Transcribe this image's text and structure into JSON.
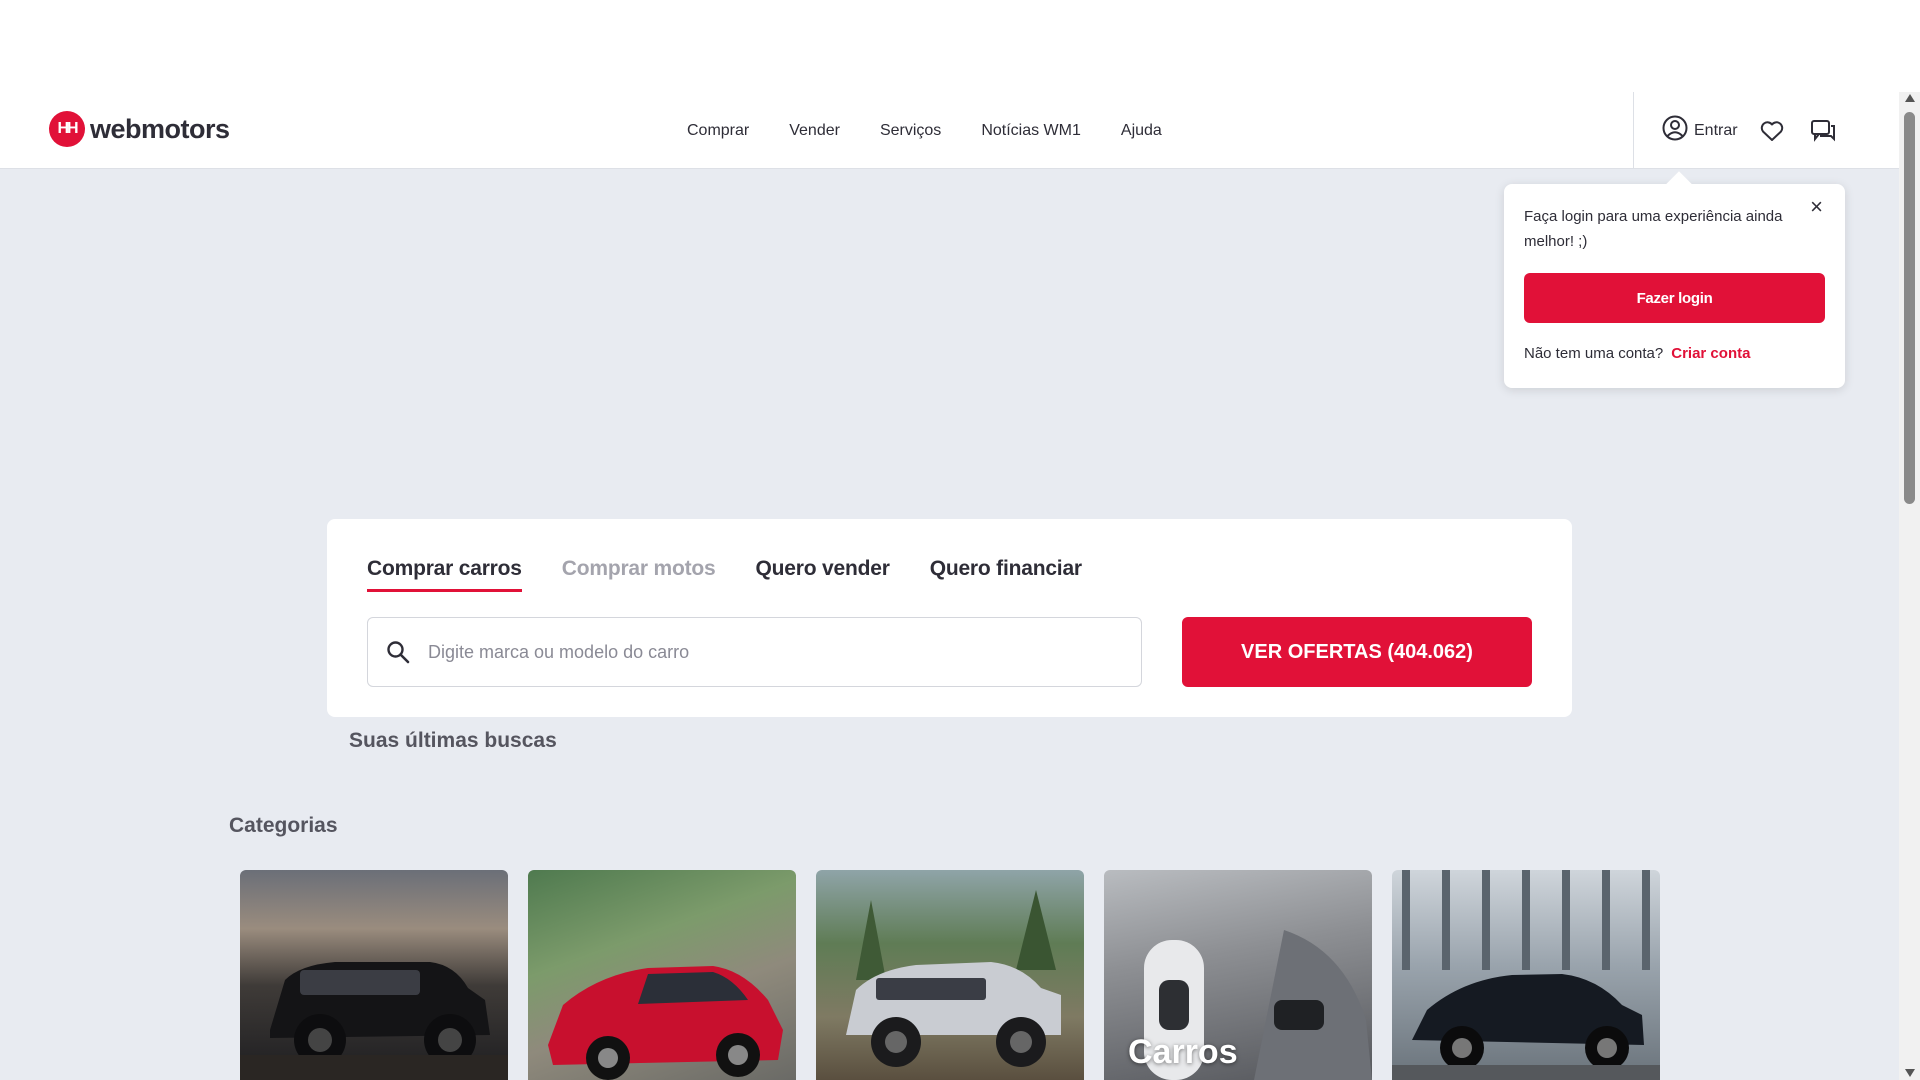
{
  "header": {
    "logo_mark": "HH",
    "logo_text": "webmotors",
    "nav": [
      "Comprar",
      "Vender",
      "Serviços",
      "Notícias WM1",
      "Ajuda"
    ],
    "login_label": "Entrar"
  },
  "popover": {
    "message": "Faça login para uma experiência ainda melhor! ;)",
    "login_button": "Fazer login",
    "no_account": "Não tem uma conta?",
    "create_account": "Criar conta",
    "close_glyph": "×"
  },
  "search": {
    "tabs": [
      "Comprar carros",
      "Comprar motos",
      "Quero vender",
      "Quero financiar"
    ],
    "active_tab": 0,
    "placeholder": "Digite marca ou modelo do carro",
    "value": "",
    "offers_button": "VER OFERTAS (404.062)"
  },
  "last_searches_title": "Suas últimas buscas",
  "categories": {
    "title": "Categorias",
    "items": [
      {
        "label": ""
      },
      {
        "label": ""
      },
      {
        "label": ""
      },
      {
        "label": "Carros"
      },
      {
        "label": ""
      }
    ]
  },
  "colors": {
    "brand": "#e11138",
    "text": "#2e2d37",
    "page_bg": "#e8ebf1"
  },
  "icons": [
    "user-icon",
    "heart-icon",
    "chat-icon",
    "search-icon",
    "close-icon"
  ]
}
